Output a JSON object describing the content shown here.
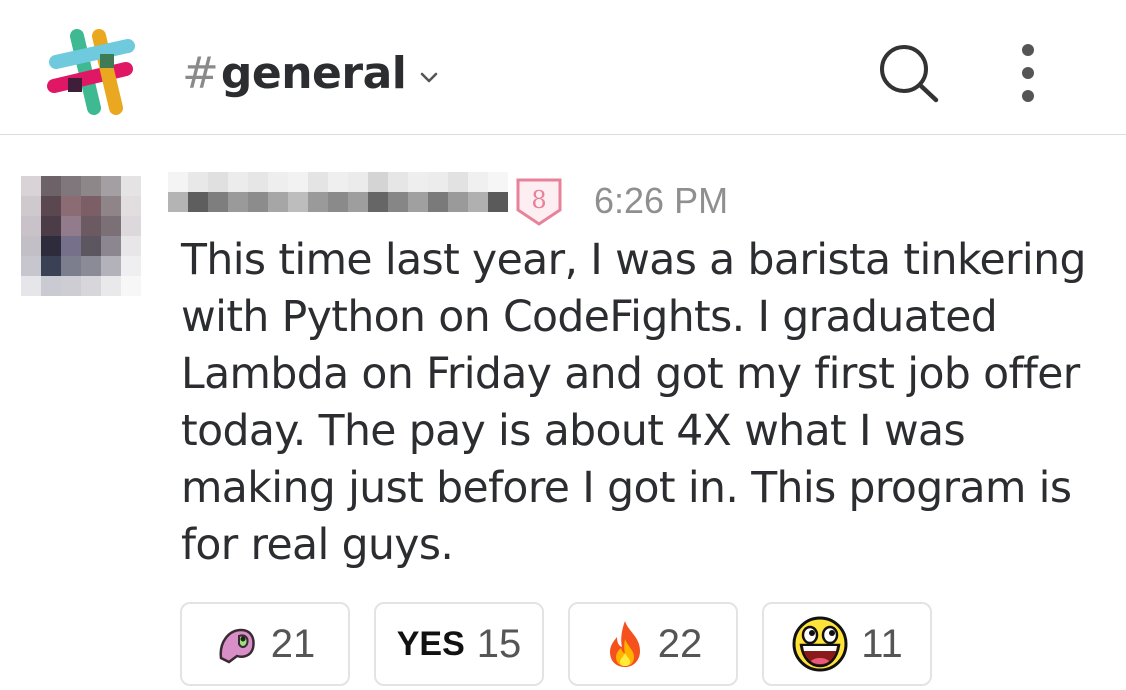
{
  "header": {
    "channel_hash": "#",
    "channel_name": "general"
  },
  "message": {
    "badge_text": "8",
    "time": "6:26 PM",
    "text": "This time last year, I was a barista tinkering\nwith Python on CodeFights. I graduated\nLambda on Friday and got my first job offer\ntoday. The pay is about 4X what I was\nmaking just before I got in. This program is\nfor real guys.",
    "reactions": [
      {
        "icon": "partyparrot-icon",
        "count": "21"
      },
      {
        "icon": "yes-icon",
        "label": "YES",
        "count": "15"
      },
      {
        "icon": "fire-icon",
        "count": "22"
      },
      {
        "icon": "awesome-face-icon",
        "count": "11"
      }
    ]
  },
  "colors": {
    "divider": "#dcdcdc",
    "text": "#2c2d30",
    "muted": "#8f8f8f",
    "badge": "#e8829a"
  }
}
